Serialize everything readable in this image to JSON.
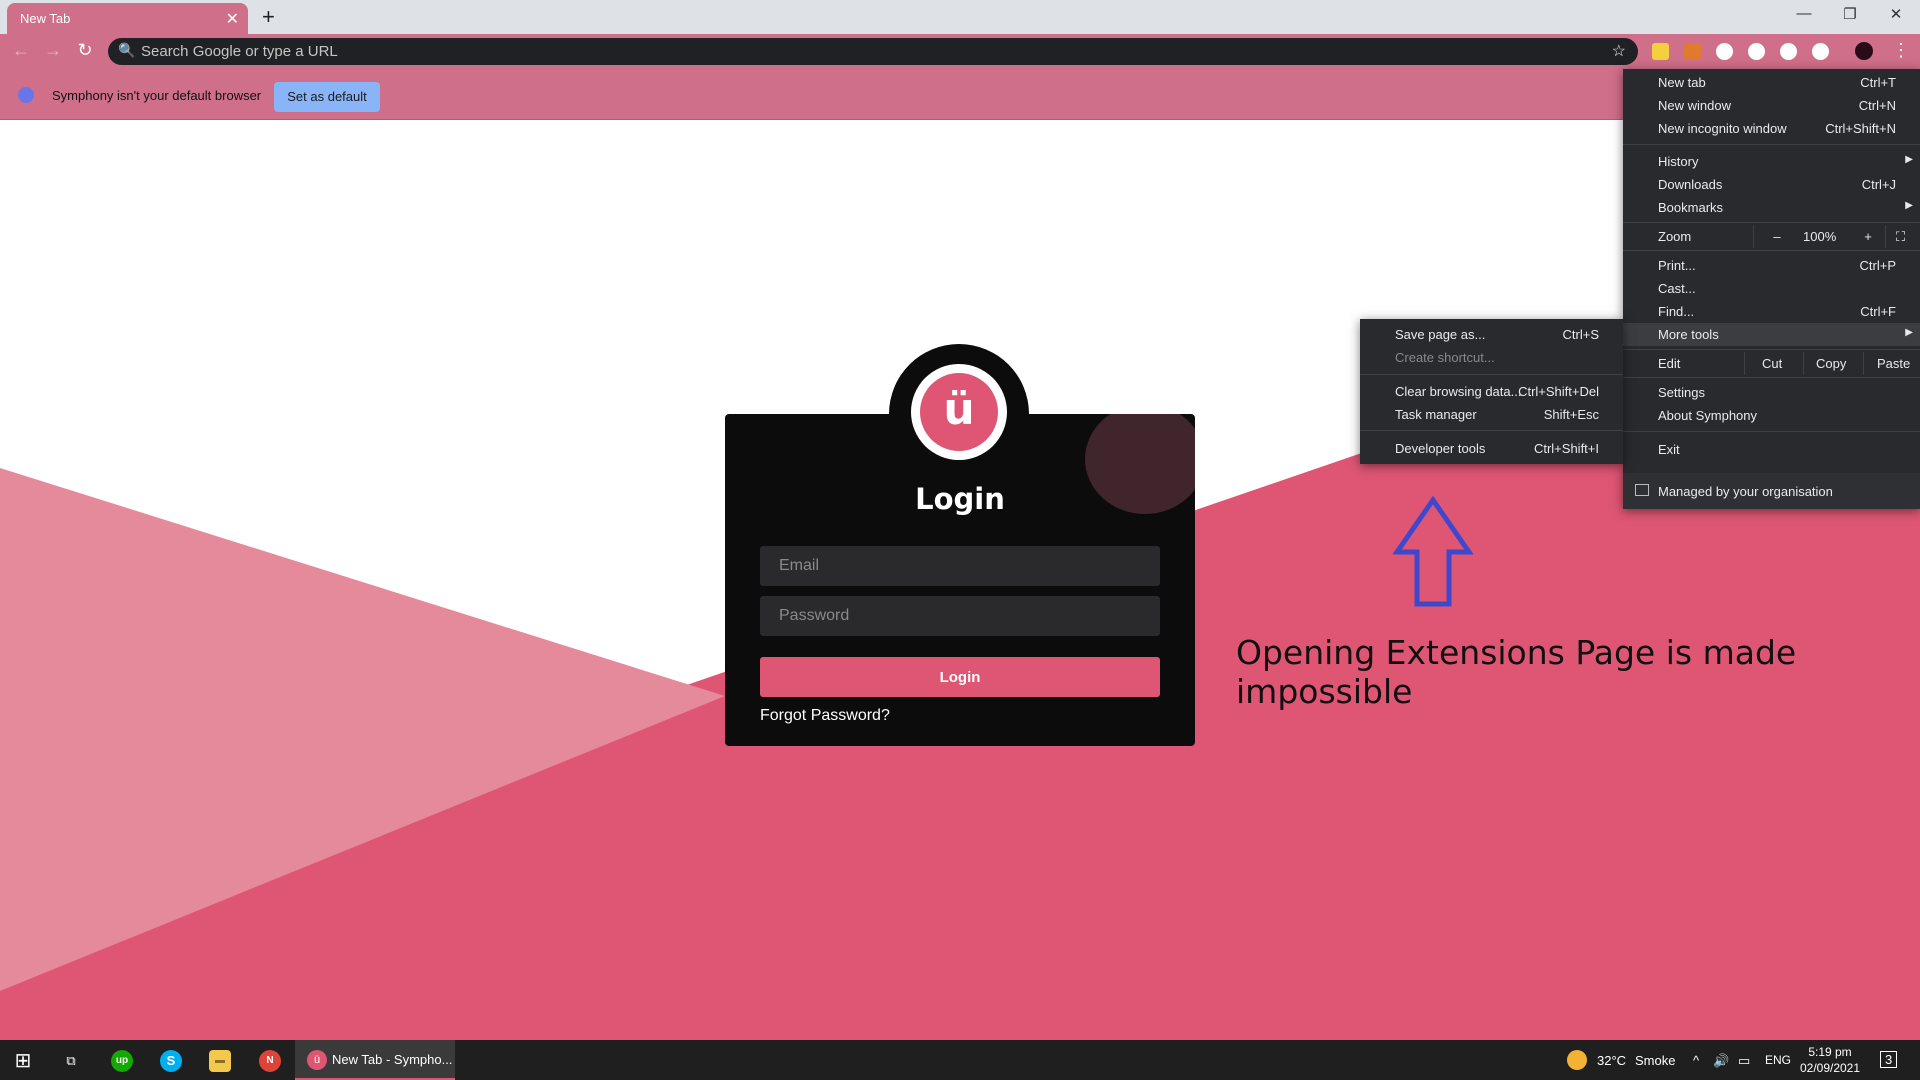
{
  "tab": {
    "title": "New Tab",
    "close": "✕",
    "new_tab": "+"
  },
  "window": {
    "minimize": "—",
    "restore": "❐",
    "close": "✕"
  },
  "toolbar": {
    "back": "←",
    "forward": "→",
    "reload": "↻",
    "search_icon": "🔍",
    "omnibox_placeholder": "Search Google or type a URL",
    "bookmark_star": "☆",
    "menu": "⋮"
  },
  "infobar": {
    "message": "Symphony isn't your default browser",
    "button": "Set as default"
  },
  "login": {
    "title": "Login",
    "logo_letter": "ü",
    "email_placeholder": "Email",
    "password_placeholder": "Password",
    "button": "Login",
    "forgot": "Forgot Password?"
  },
  "annotation": {
    "text": "Opening Extensions Page is made impossible",
    "arrow_color": "#3f48cc"
  },
  "main_menu": {
    "new_tab": {
      "label": "New tab",
      "shortcut": "Ctrl+T"
    },
    "new_window": {
      "label": "New window",
      "shortcut": "Ctrl+N"
    },
    "new_incognito": {
      "label": "New incognito window",
      "shortcut": "Ctrl+Shift+N"
    },
    "history": {
      "label": "History"
    },
    "downloads": {
      "label": "Downloads",
      "shortcut": "Ctrl+J"
    },
    "bookmarks": {
      "label": "Bookmarks"
    },
    "zoom": {
      "label": "Zoom",
      "minus": "–",
      "value": "100%",
      "plus": "+",
      "fullscreen": "⛶"
    },
    "print": {
      "label": "Print...",
      "shortcut": "Ctrl+P"
    },
    "cast": {
      "label": "Cast..."
    },
    "find": {
      "label": "Find...",
      "shortcut": "Ctrl+F"
    },
    "more_tools": {
      "label": "More tools"
    },
    "edit": {
      "label": "Edit",
      "cut": "Cut",
      "copy": "Copy",
      "paste": "Paste"
    },
    "settings": {
      "label": "Settings"
    },
    "about": {
      "label": "About Symphony"
    },
    "exit": {
      "label": "Exit"
    },
    "managed": {
      "label": "Managed by your organisation"
    }
  },
  "sub_menu": {
    "save_page": {
      "label": "Save page as...",
      "shortcut": "Ctrl+S"
    },
    "create_shortcut": {
      "label": "Create shortcut..."
    },
    "clear_data": {
      "label": "Clear browsing data...",
      "shortcut": "Ctrl+Shift+Del"
    },
    "task_manager": {
      "label": "Task manager",
      "shortcut": "Shift+Esc"
    },
    "dev_tools": {
      "label": "Developer tools",
      "shortcut": "Ctrl+Shift+I"
    }
  },
  "taskbar": {
    "start": "⊞",
    "task_view": "⧉",
    "upwork": "up",
    "skype": "S",
    "explorer": "▬",
    "chrome_app": "N",
    "active_app_title": "New Tab - Sympho...",
    "weather_temp": "32°C",
    "weather_desc": "Smoke",
    "chevron": "^",
    "volume": "🔊",
    "network": "▭",
    "lang": "ENG",
    "time": "5:19 pm",
    "date": "02/09/2021",
    "notifications": "3"
  },
  "colors": {
    "accent": "#de5673",
    "toolbar": "#cf6f8a",
    "menu_bg": "#292a2d",
    "light_pink": "#e48a9a"
  }
}
